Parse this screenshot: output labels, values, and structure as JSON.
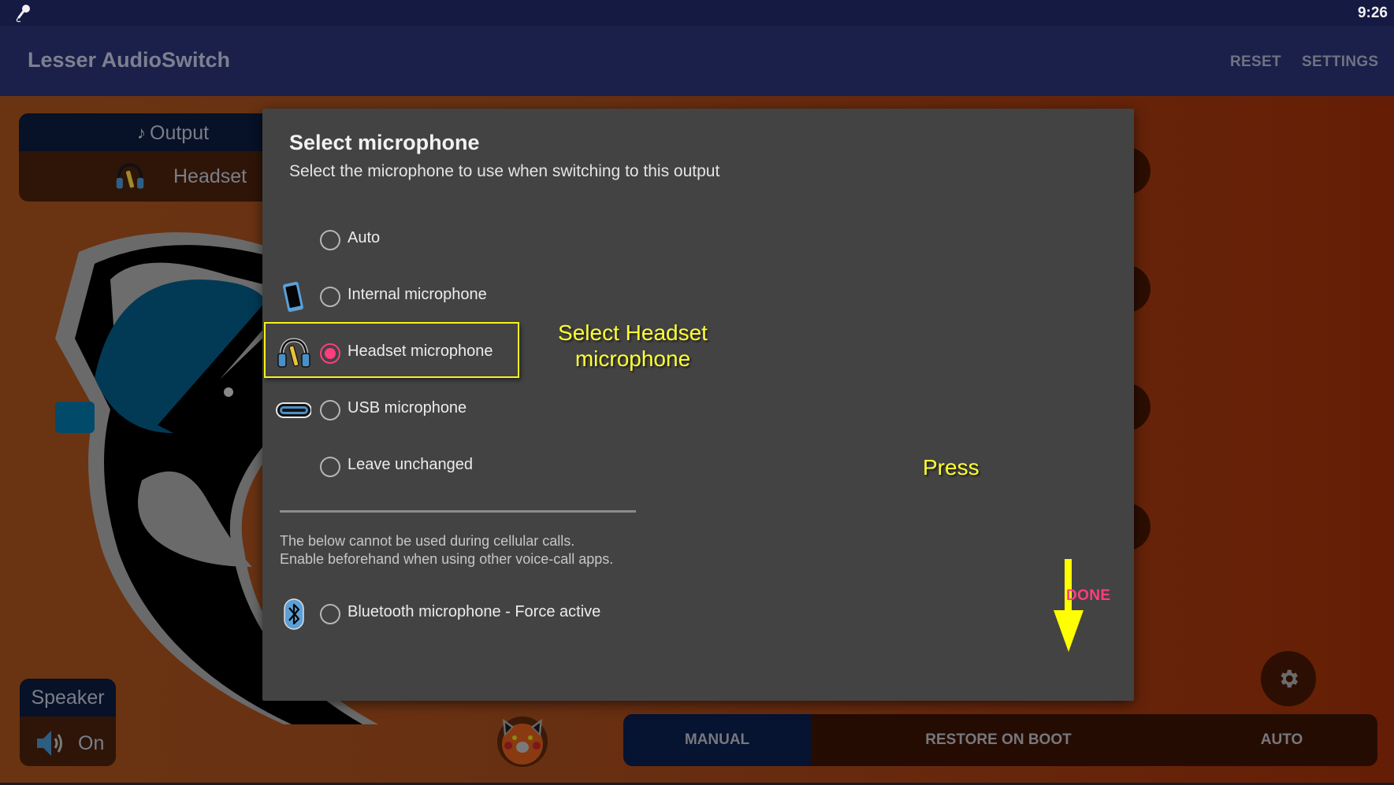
{
  "status_bar": {
    "time": "9:26",
    "notification_icon": "microphone-icon"
  },
  "app_bar": {
    "title": "Lesser AudioSwitch",
    "actions": [
      {
        "label": "RESET"
      },
      {
        "label": "SETTINGS"
      }
    ]
  },
  "background": {
    "output_card": {
      "label": "Output",
      "note_icon": "music-note-icon",
      "value": "Headset",
      "value_icon": "headset-icon"
    },
    "speaker_card": {
      "label": "Speaker",
      "value": "On",
      "value_icon": "speaker-icon"
    },
    "mode_tabs": [
      {
        "label": "MANUAL",
        "selected": true
      },
      {
        "label": "RESTORE ON BOOT",
        "selected": false
      },
      {
        "label": "AUTO",
        "selected": false
      }
    ],
    "fab_icon": "gear-icon"
  },
  "dialog": {
    "title": "Select microphone",
    "subtitle": "Select the microphone to use when switching to this output",
    "options": [
      {
        "label": "Auto",
        "icon": null,
        "checked": false
      },
      {
        "label": "Internal microphone",
        "icon": "phone-icon",
        "checked": false
      },
      {
        "label": "Headset microphone",
        "icon": "headset-icon",
        "checked": true
      },
      {
        "label": "USB microphone",
        "icon": "usb-c-icon",
        "checked": false
      },
      {
        "label": "Leave unchanged",
        "icon": null,
        "checked": false
      }
    ],
    "note_lines": [
      "The below cannot be used during cellular calls.",
      "Enable beforehand when using other voice-call apps."
    ],
    "extra_option": {
      "label": "Bluetooth microphone - Force active",
      "icon": "bluetooth-icon",
      "checked": false
    },
    "done_label": "DONE"
  },
  "annotations": {
    "select_line1": "Select Headset",
    "select_line2": "microphone",
    "press": "Press",
    "color": "#ffff33"
  },
  "colors": {
    "accent": "#ff3d7f",
    "dialog_bg": "#434343",
    "app_bar": "#1a2049",
    "status_bar": "#151a42",
    "stage": "#683012"
  }
}
